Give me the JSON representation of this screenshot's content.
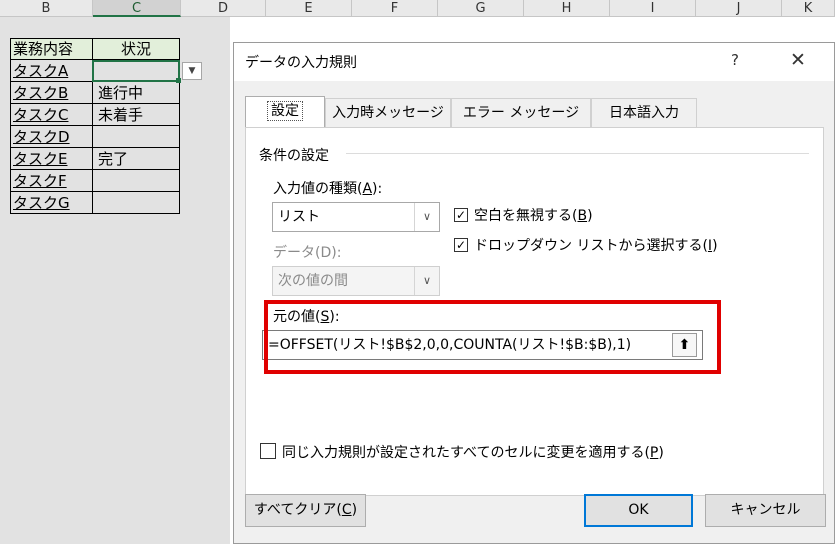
{
  "spreadsheet": {
    "columns": [
      "B",
      "C",
      "D",
      "E",
      "F",
      "G",
      "H",
      "I",
      "J",
      "K"
    ],
    "header": {
      "col_b": "業務内容",
      "col_c": "状況"
    },
    "rows": [
      {
        "task": "タスクA",
        "status": ""
      },
      {
        "task": "タスクB",
        "status": "進行中"
      },
      {
        "task": "タスクC",
        "status": "未着手"
      },
      {
        "task": "タスクD",
        "status": ""
      },
      {
        "task": "タスクE",
        "status": "完了"
      },
      {
        "task": "タスクF",
        "status": ""
      },
      {
        "task": "タスクG",
        "status": ""
      }
    ],
    "dropdown_icon": "triangle-down"
  },
  "dialog": {
    "title": "データの入力規則",
    "help": "?",
    "close": "✕",
    "tabs": [
      "設定",
      "入力時メッセージ",
      "エラー メッセージ",
      "日本語入力"
    ],
    "active_tab": "設定",
    "group_label": "条件の設定",
    "allow_label": "入力値の種類(",
    "allow_key": "A",
    "allow_suffix": "):",
    "allow_value": "リスト",
    "ignore_blank_label": "空白を無視する(",
    "ignore_blank_key": "B",
    "ignore_blank_checked": true,
    "dropdown_label": "ドロップダウン リストから選択する(",
    "dropdown_key": "I",
    "dropdown_checked": true,
    "data_label": "データ(D):",
    "data_value": "次の値の間",
    "source_label": "元の値(",
    "source_key": "S",
    "source_suffix": "):",
    "source_value": "=OFFSET(リスト!$B$2,0,0,COUNTA(リスト!$B:$B),1)",
    "apply_all_label": "同じ入力規則が設定されたすべてのセルに変更を適用する(",
    "apply_all_key": "P",
    "apply_all_checked": false,
    "clear_all_label": "すべてクリア(",
    "clear_all_key": "C",
    "ok_label": "OK",
    "cancel_label": "キャンセル",
    "highlight_color": "#e00000"
  }
}
